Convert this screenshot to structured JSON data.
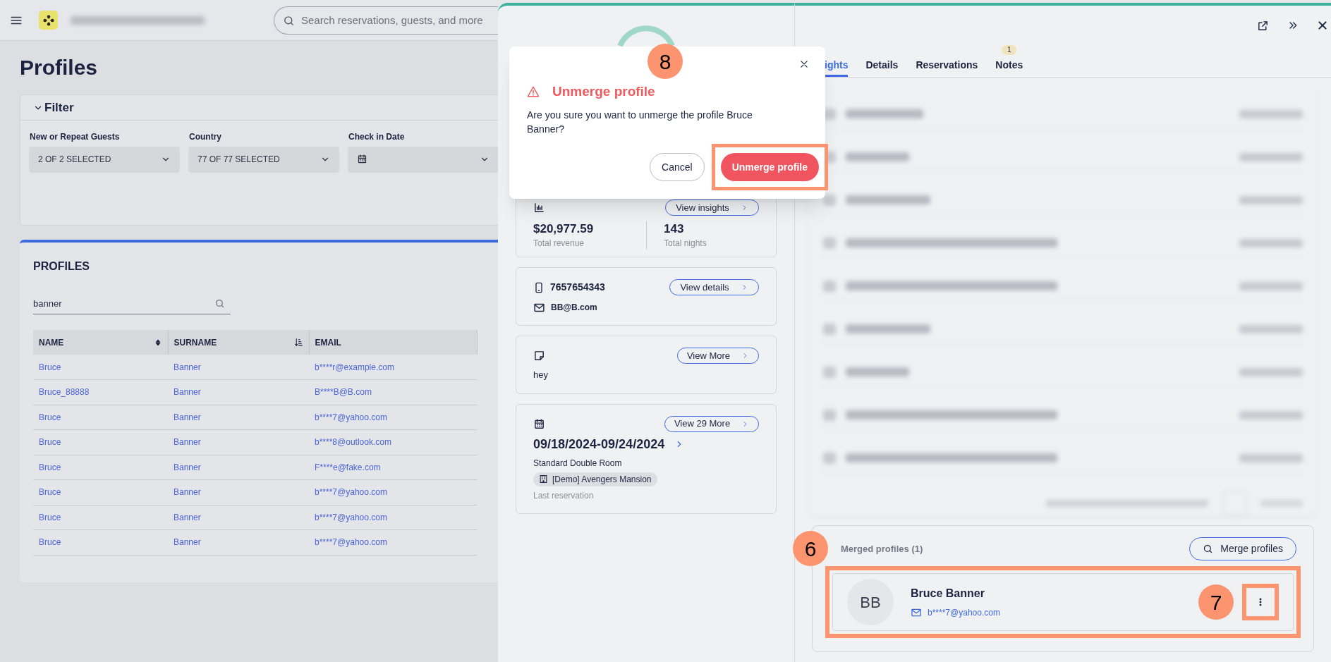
{
  "header": {
    "search_placeholder": "Search reservations, guests, and more"
  },
  "page_title": "Profiles",
  "filter": {
    "title": "Filter",
    "expanded": true,
    "fields": [
      {
        "label": "New or Repeat Guests",
        "value": "2 OF 2 SELECTED",
        "kind": "select"
      },
      {
        "label": "Country",
        "value": "77 OF 77 SELECTED",
        "kind": "select"
      },
      {
        "label": "Check in Date",
        "kind": "date"
      }
    ]
  },
  "profiles": {
    "title": "PROFILES",
    "search_value": "banner",
    "columns": [
      {
        "label": "NAME",
        "kind": "sortable"
      },
      {
        "label": "SURNAME",
        "kind": "sorted"
      },
      {
        "label": "EMAIL",
        "kind": "plain"
      }
    ],
    "rows": [
      [
        "Bruce",
        "Banner",
        "b****r@example.com"
      ],
      [
        "Bruce_88888",
        "Banner",
        "B****B@B.com"
      ],
      [
        "Bruce",
        "Banner",
        "b****7@yahoo.com"
      ],
      [
        "Bruce",
        "Banner",
        "b****8@outlook.com"
      ],
      [
        "Bruce",
        "Banner",
        "F****e@fake.com"
      ],
      [
        "Bruce",
        "Banner",
        "b****7@yahoo.com"
      ],
      [
        "Bruce",
        "Banner",
        "b****7@yahoo.com"
      ],
      [
        "Bruce",
        "Banner",
        "b****7@yahoo.com"
      ]
    ]
  },
  "panel": {
    "cards": [
      {
        "kind": "insights",
        "button": "View insights",
        "stats": [
          {
            "value": "$20,977.59",
            "label": "Total revenue"
          },
          {
            "value": "143",
            "label": "Total nights"
          }
        ]
      },
      {
        "kind": "contact",
        "button": "View details",
        "phone": "7657654343",
        "email": "BB@B.com"
      },
      {
        "kind": "note",
        "button": "View More",
        "text": "hey"
      },
      {
        "kind": "reservation",
        "button": "View 29 More",
        "dates": "09/18/2024-09/24/2024",
        "room": "Standard Double Room",
        "property": "[Demo] Avengers Mansion",
        "caption": "Last reservation"
      }
    ],
    "tabs": [
      {
        "label": "ights",
        "selected": true
      },
      {
        "label": "Details",
        "selected": false
      },
      {
        "label": "Reservations",
        "selected": false
      },
      {
        "label": "Notes",
        "selected": false,
        "badge": "1"
      }
    ],
    "merged": {
      "title": "Merged profiles (1)",
      "marker": "6",
      "button": "Merge profiles",
      "items": [
        {
          "initials": "BB",
          "name": "Bruce Banner",
          "email": "b****7@yahoo.com",
          "highlighted": true,
          "menu_highlighted": true,
          "menu_marker": "7"
        }
      ]
    }
  },
  "dialog": {
    "marker": "8",
    "title": "Unmerge profile",
    "message": "Are you sure you want to unmerge the profile Bruce Banner?",
    "buttons": [
      {
        "label": "Cancel",
        "kind": "secondary",
        "highlighted": false
      },
      {
        "label": "Unmerge profile",
        "kind": "danger",
        "highlighted": true
      }
    ]
  }
}
